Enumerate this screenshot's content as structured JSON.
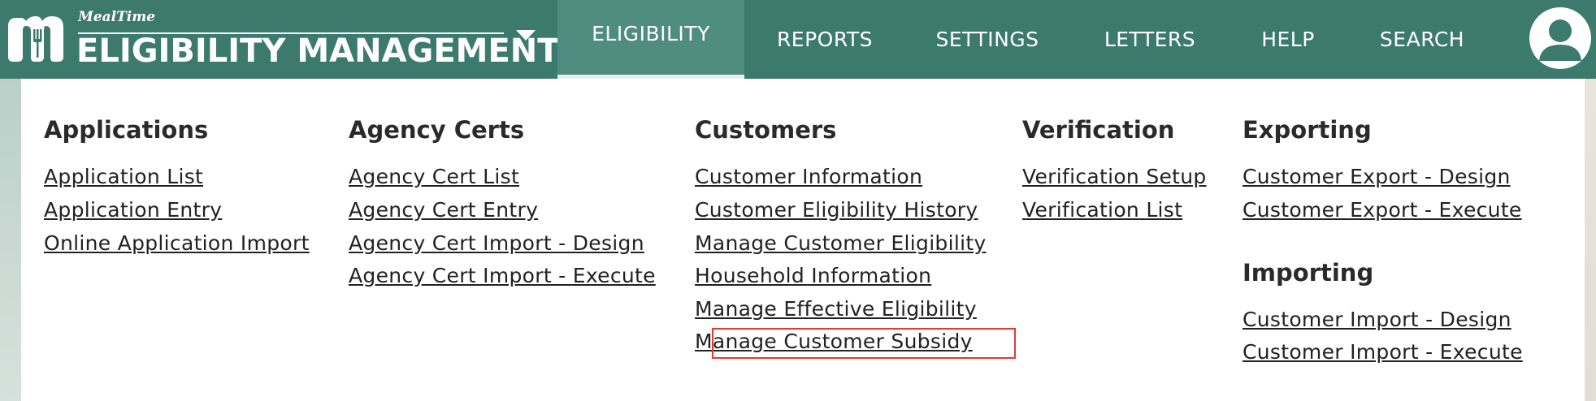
{
  "brand": {
    "small_name": "MealTime",
    "title": "ELIGIBILITY MANAGEMENT"
  },
  "nav": {
    "items": [
      {
        "label": "ELIGIBILITY",
        "active": true
      },
      {
        "label": "REPORTS"
      },
      {
        "label": "SETTINGS"
      },
      {
        "label": "LETTERS"
      },
      {
        "label": "HELP"
      },
      {
        "label": "SEARCH"
      }
    ]
  },
  "menu": {
    "columns": [
      {
        "heading": "Applications",
        "links": [
          "Application List",
          "Application Entry",
          "Online Application Import"
        ]
      },
      {
        "heading": "Agency Certs",
        "links": [
          "Agency Cert List",
          "Agency Cert Entry",
          "Agency Cert Import - Design",
          "Agency Cert Import - Execute"
        ]
      },
      {
        "heading": "Customers",
        "links": [
          "Customer Information",
          "Customer Eligibility History",
          "Manage Customer Eligibility",
          "Household Information",
          "Manage Effective Eligibility",
          "Manage Customer Subsidy"
        ]
      },
      {
        "heading": "Verification",
        "links": [
          "Verification Setup",
          "Verification List"
        ]
      },
      {
        "heading": "Exporting",
        "links": [
          "Customer Export - Design",
          "Customer Export - Execute"
        ]
      },
      {
        "heading": "Importing",
        "links": [
          "Customer Import - Design",
          "Customer Import - Execute"
        ]
      }
    ]
  },
  "colors": {
    "header_bg": "#3d7a6e",
    "active_tab_bg": "#4f8d80",
    "highlight_border": "#e03a33"
  }
}
